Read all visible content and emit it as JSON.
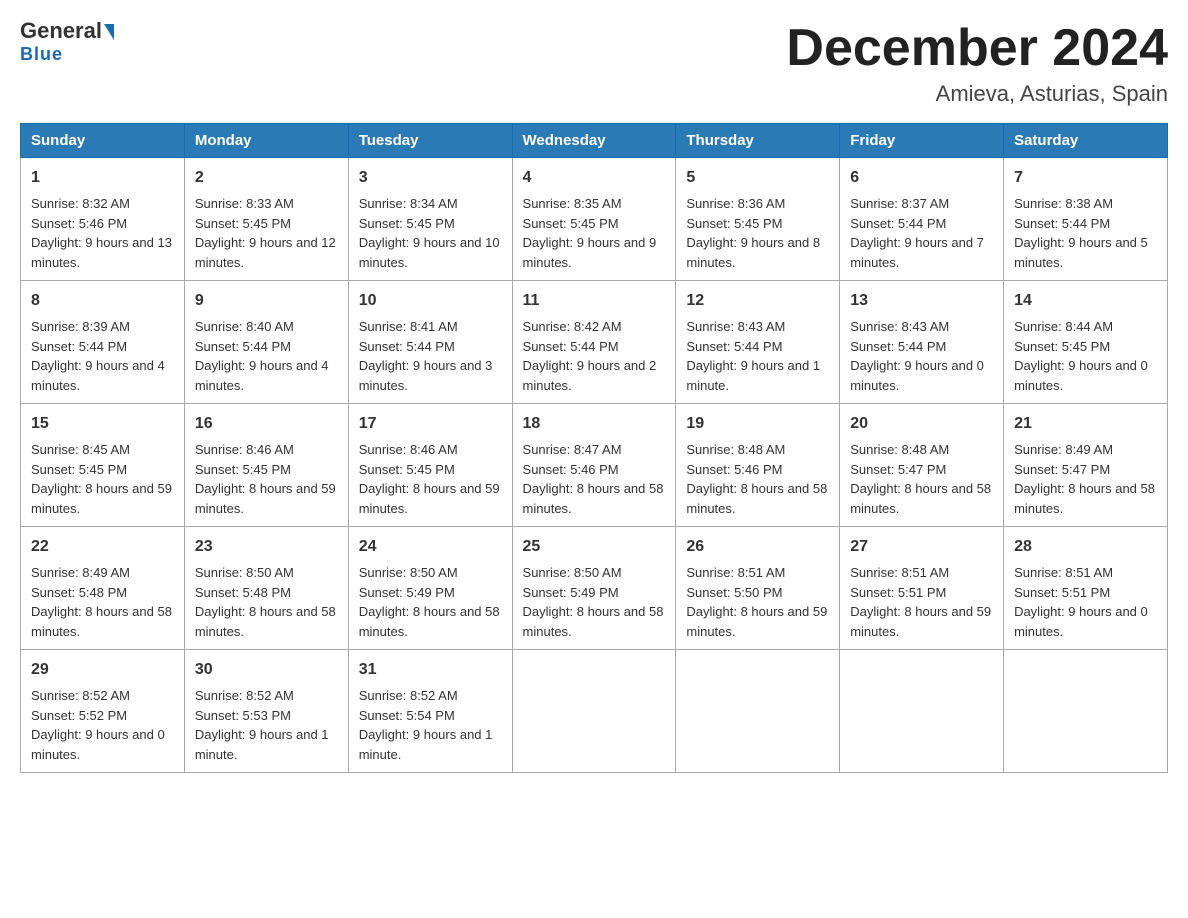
{
  "header": {
    "logo_general": "General",
    "logo_blue": "Blue",
    "month_title": "December 2024",
    "location": "Amieva, Asturias, Spain"
  },
  "days_of_week": [
    "Sunday",
    "Monday",
    "Tuesday",
    "Wednesday",
    "Thursday",
    "Friday",
    "Saturday"
  ],
  "weeks": [
    [
      {
        "num": "1",
        "sunrise": "8:32 AM",
        "sunset": "5:46 PM",
        "daylight": "9 hours and 13 minutes."
      },
      {
        "num": "2",
        "sunrise": "8:33 AM",
        "sunset": "5:45 PM",
        "daylight": "9 hours and 12 minutes."
      },
      {
        "num": "3",
        "sunrise": "8:34 AM",
        "sunset": "5:45 PM",
        "daylight": "9 hours and 10 minutes."
      },
      {
        "num": "4",
        "sunrise": "8:35 AM",
        "sunset": "5:45 PM",
        "daylight": "9 hours and 9 minutes."
      },
      {
        "num": "5",
        "sunrise": "8:36 AM",
        "sunset": "5:45 PM",
        "daylight": "9 hours and 8 minutes."
      },
      {
        "num": "6",
        "sunrise": "8:37 AM",
        "sunset": "5:44 PM",
        "daylight": "9 hours and 7 minutes."
      },
      {
        "num": "7",
        "sunrise": "8:38 AM",
        "sunset": "5:44 PM",
        "daylight": "9 hours and 5 minutes."
      }
    ],
    [
      {
        "num": "8",
        "sunrise": "8:39 AM",
        "sunset": "5:44 PM",
        "daylight": "9 hours and 4 minutes."
      },
      {
        "num": "9",
        "sunrise": "8:40 AM",
        "sunset": "5:44 PM",
        "daylight": "9 hours and 4 minutes."
      },
      {
        "num": "10",
        "sunrise": "8:41 AM",
        "sunset": "5:44 PM",
        "daylight": "9 hours and 3 minutes."
      },
      {
        "num": "11",
        "sunrise": "8:42 AM",
        "sunset": "5:44 PM",
        "daylight": "9 hours and 2 minutes."
      },
      {
        "num": "12",
        "sunrise": "8:43 AM",
        "sunset": "5:44 PM",
        "daylight": "9 hours and 1 minute."
      },
      {
        "num": "13",
        "sunrise": "8:43 AM",
        "sunset": "5:44 PM",
        "daylight": "9 hours and 0 minutes."
      },
      {
        "num": "14",
        "sunrise": "8:44 AM",
        "sunset": "5:45 PM",
        "daylight": "9 hours and 0 minutes."
      }
    ],
    [
      {
        "num": "15",
        "sunrise": "8:45 AM",
        "sunset": "5:45 PM",
        "daylight": "8 hours and 59 minutes."
      },
      {
        "num": "16",
        "sunrise": "8:46 AM",
        "sunset": "5:45 PM",
        "daylight": "8 hours and 59 minutes."
      },
      {
        "num": "17",
        "sunrise": "8:46 AM",
        "sunset": "5:45 PM",
        "daylight": "8 hours and 59 minutes."
      },
      {
        "num": "18",
        "sunrise": "8:47 AM",
        "sunset": "5:46 PM",
        "daylight": "8 hours and 58 minutes."
      },
      {
        "num": "19",
        "sunrise": "8:48 AM",
        "sunset": "5:46 PM",
        "daylight": "8 hours and 58 minutes."
      },
      {
        "num": "20",
        "sunrise": "8:48 AM",
        "sunset": "5:47 PM",
        "daylight": "8 hours and 58 minutes."
      },
      {
        "num": "21",
        "sunrise": "8:49 AM",
        "sunset": "5:47 PM",
        "daylight": "8 hours and 58 minutes."
      }
    ],
    [
      {
        "num": "22",
        "sunrise": "8:49 AM",
        "sunset": "5:48 PM",
        "daylight": "8 hours and 58 minutes."
      },
      {
        "num": "23",
        "sunrise": "8:50 AM",
        "sunset": "5:48 PM",
        "daylight": "8 hours and 58 minutes."
      },
      {
        "num": "24",
        "sunrise": "8:50 AM",
        "sunset": "5:49 PM",
        "daylight": "8 hours and 58 minutes."
      },
      {
        "num": "25",
        "sunrise": "8:50 AM",
        "sunset": "5:49 PM",
        "daylight": "8 hours and 58 minutes."
      },
      {
        "num": "26",
        "sunrise": "8:51 AM",
        "sunset": "5:50 PM",
        "daylight": "8 hours and 59 minutes."
      },
      {
        "num": "27",
        "sunrise": "8:51 AM",
        "sunset": "5:51 PM",
        "daylight": "8 hours and 59 minutes."
      },
      {
        "num": "28",
        "sunrise": "8:51 AM",
        "sunset": "5:51 PM",
        "daylight": "9 hours and 0 minutes."
      }
    ],
    [
      {
        "num": "29",
        "sunrise": "8:52 AM",
        "sunset": "5:52 PM",
        "daylight": "9 hours and 0 minutes."
      },
      {
        "num": "30",
        "sunrise": "8:52 AM",
        "sunset": "5:53 PM",
        "daylight": "9 hours and 1 minute."
      },
      {
        "num": "31",
        "sunrise": "8:52 AM",
        "sunset": "5:54 PM",
        "daylight": "9 hours and 1 minute."
      },
      null,
      null,
      null,
      null
    ]
  ],
  "labels": {
    "sunrise_label": "Sunrise:",
    "sunset_label": "Sunset:",
    "daylight_label": "Daylight:"
  }
}
